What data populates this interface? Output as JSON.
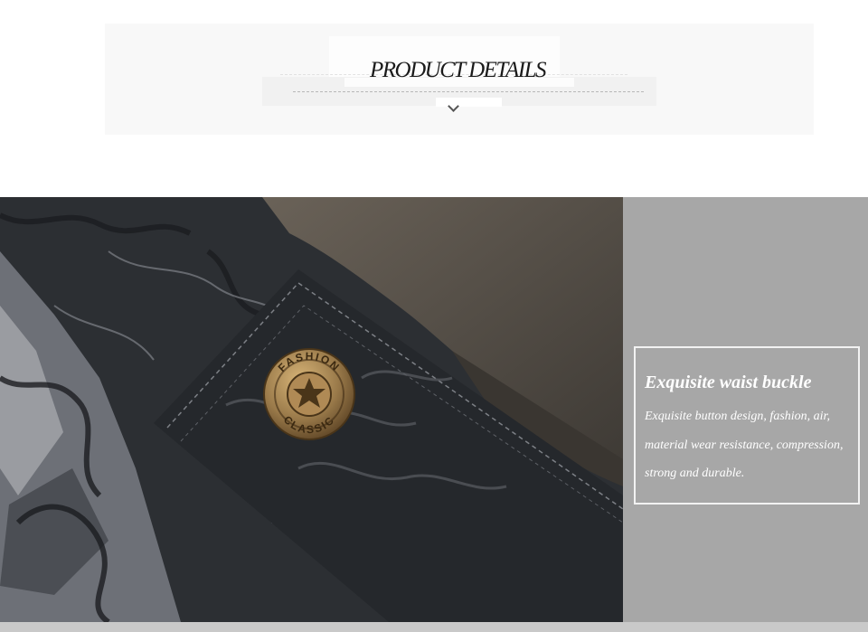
{
  "header": {
    "title": "PRODUCT DETAILS",
    "toggle_icon": "chevron-down-icon"
  },
  "feature": {
    "title": "Exquisite waist buckle",
    "description": "Exquisite button design, fashion, air, material wear resistance, compression, strong and durable."
  },
  "button_emblem": {
    "top_text": "FASHION",
    "bottom_text": "CLASSIC"
  },
  "colors": {
    "panel_grey": "#a7a7a7",
    "fabric_dark": "#2c2f33",
    "fleece_brown": "#5a5148",
    "button_bronze": "#9a7a4a"
  }
}
